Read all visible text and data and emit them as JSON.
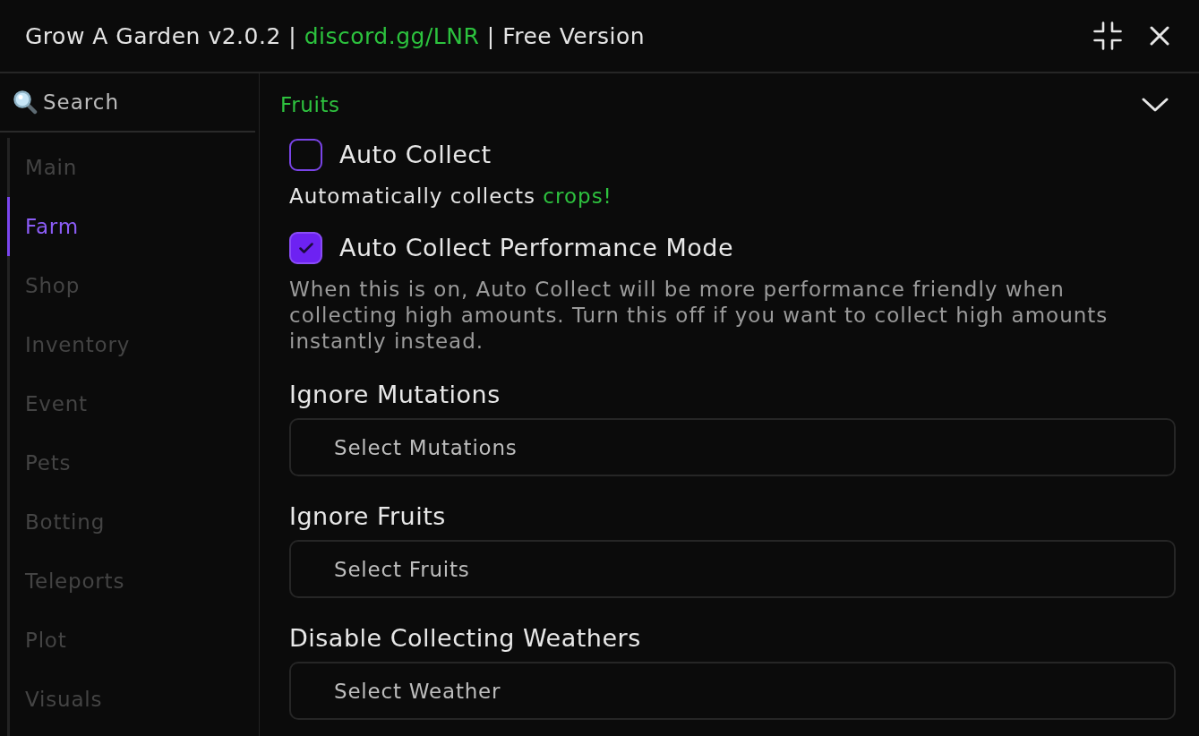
{
  "window": {
    "title": [
      {
        "kind": "text",
        "text": "Grow A Garden v2.0.2 |"
      },
      {
        "kind": "link",
        "text": "discord.gg/LNR"
      },
      {
        "kind": "text",
        "text": "| Free Version"
      }
    ]
  },
  "sidebar": {
    "search": {
      "placeholder": "Search"
    },
    "items": [
      {
        "label": "Main",
        "selected": false
      },
      {
        "label": "Farm",
        "selected": true
      },
      {
        "label": "Shop",
        "selected": false
      },
      {
        "label": "Inventory",
        "selected": false
      },
      {
        "label": "Event",
        "selected": false
      },
      {
        "label": "Pets",
        "selected": false
      },
      {
        "label": "Botting",
        "selected": false
      },
      {
        "label": "Teleports",
        "selected": false
      },
      {
        "label": "Plot",
        "selected": false
      },
      {
        "label": "Visuals",
        "selected": false
      }
    ]
  },
  "section": {
    "title": "Fruits",
    "expanded": true,
    "options": [
      {
        "kind": "checkbox",
        "label": "Auto Collect",
        "checked": false,
        "description": [
          {
            "kind": "plain",
            "text": "Automatically collects"
          },
          {
            "kind": "accent",
            "text": "crops!"
          }
        ]
      },
      {
        "kind": "checkbox",
        "label": "Auto Collect Performance Mode",
        "checked": true,
        "description": [
          {
            "kind": "muted",
            "text": "When this is on, Auto Collect will be more performance friendly when collecting high amounts. Turn this off if you want to collect high amounts instantly instead."
          }
        ]
      },
      {
        "kind": "dropdown",
        "label": "Ignore Mutations",
        "placeholder": "Select Mutations"
      },
      {
        "kind": "dropdown",
        "label": "Ignore Fruits",
        "placeholder": "Select Fruits"
      },
      {
        "kind": "dropdown",
        "label": "Disable Collecting Weathers",
        "placeholder": "Select Weather"
      }
    ]
  }
}
